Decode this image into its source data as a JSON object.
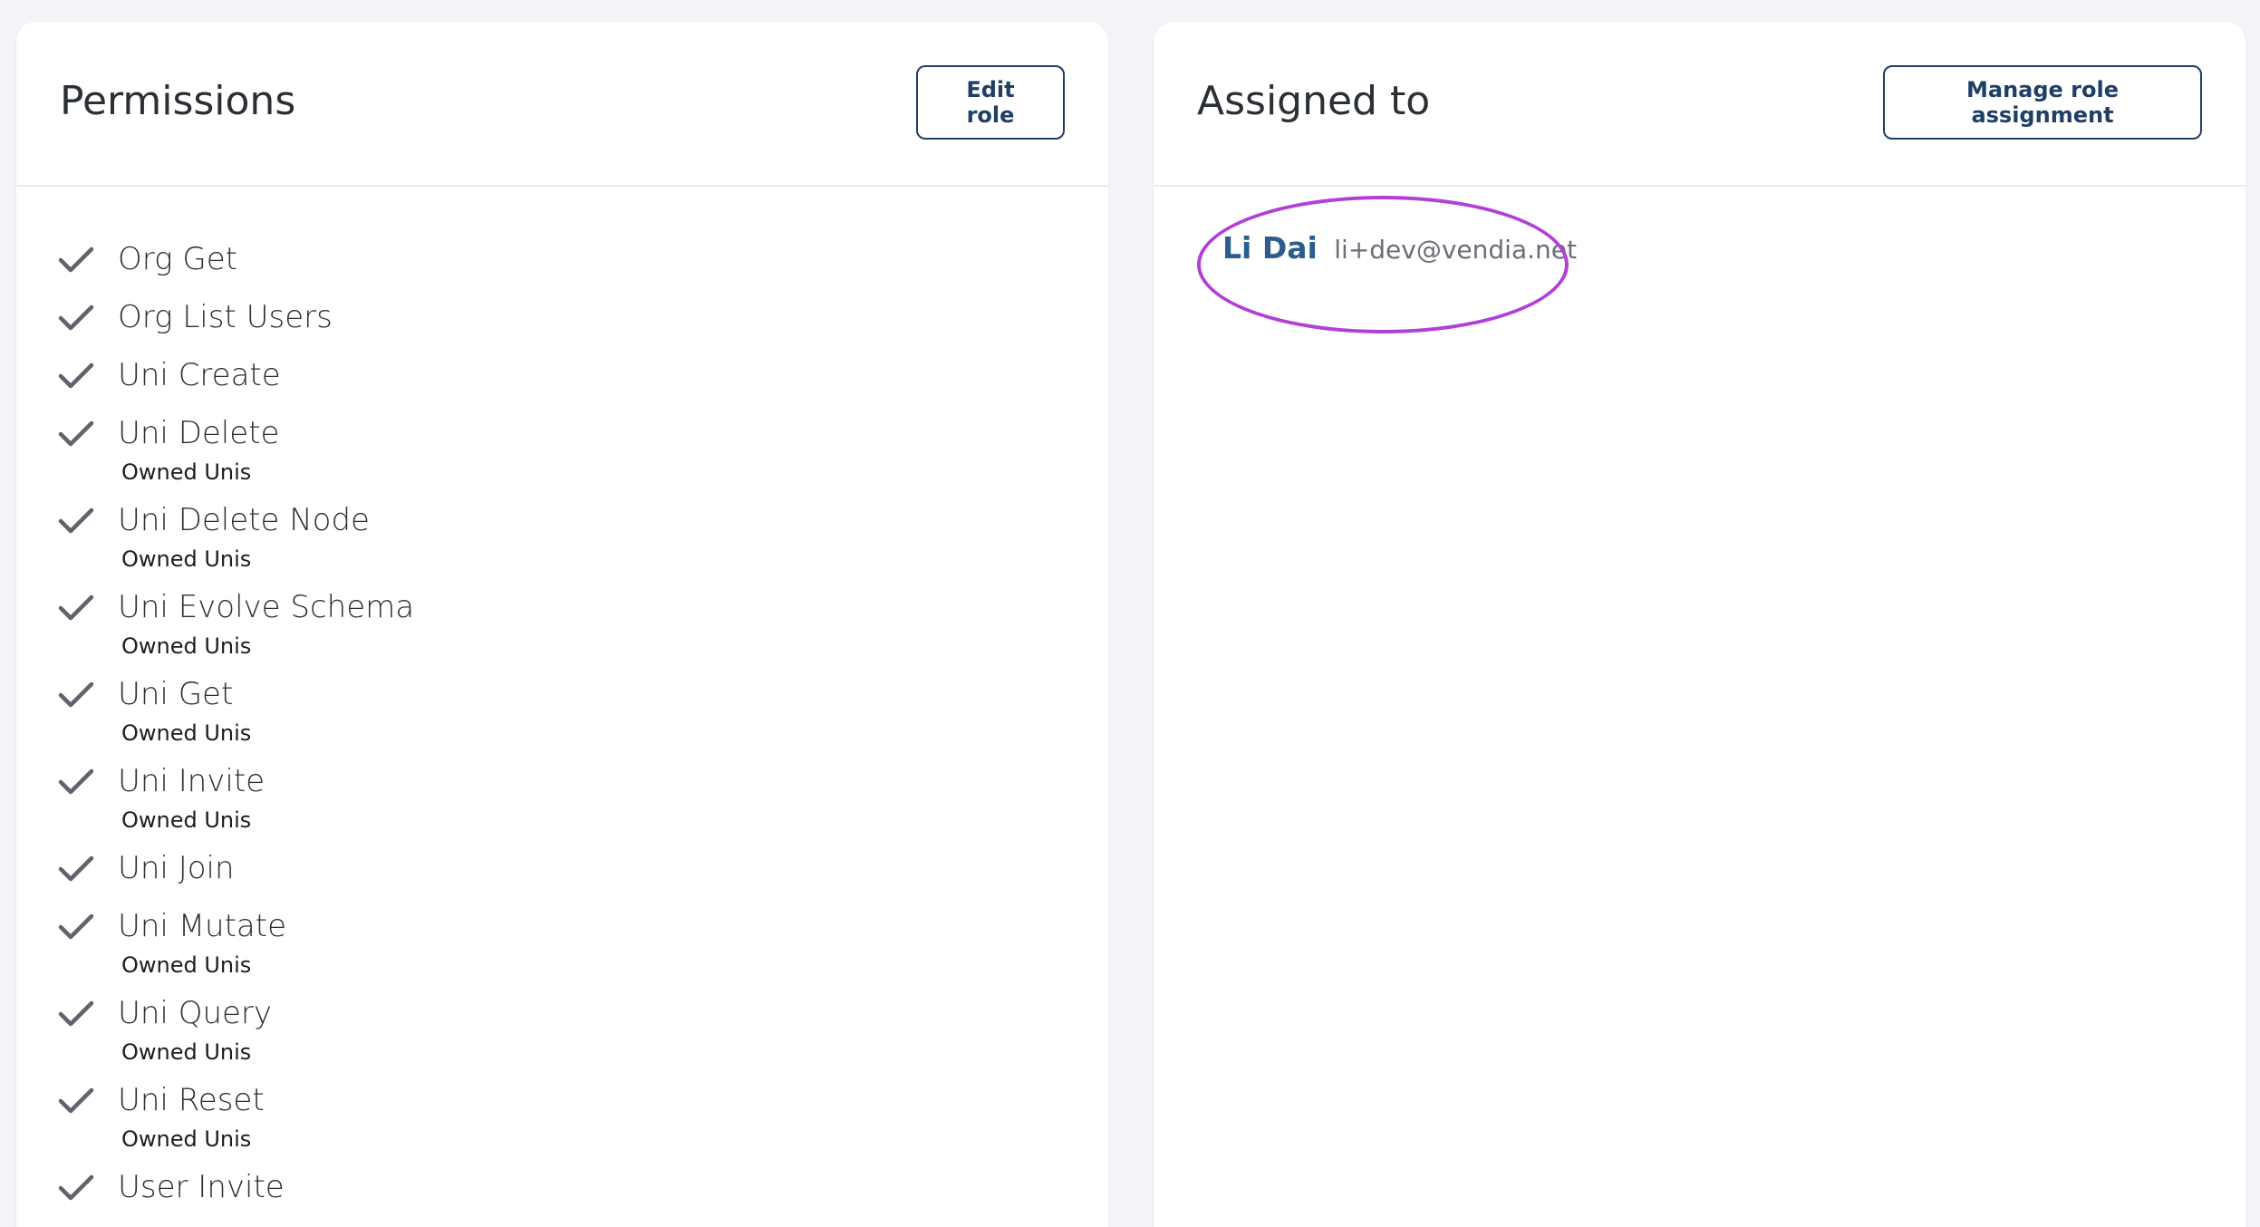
{
  "permissions_card": {
    "title": "Permissions",
    "edit_button_label": "Edit role",
    "items": [
      {
        "name": "Org Get",
        "scope": ""
      },
      {
        "name": "Org List Users",
        "scope": ""
      },
      {
        "name": "Uni Create",
        "scope": ""
      },
      {
        "name": "Uni Delete",
        "scope": "Owned Unis"
      },
      {
        "name": "Uni Delete Node",
        "scope": "Owned Unis"
      },
      {
        "name": "Uni Evolve Schema",
        "scope": "Owned Unis"
      },
      {
        "name": "Uni Get",
        "scope": "Owned Unis"
      },
      {
        "name": "Uni Invite",
        "scope": "Owned Unis"
      },
      {
        "name": "Uni Join",
        "scope": ""
      },
      {
        "name": "Uni Mutate",
        "scope": "Owned Unis"
      },
      {
        "name": "Uni Query",
        "scope": "Owned Unis"
      },
      {
        "name": "Uni Reset",
        "scope": "Owned Unis"
      },
      {
        "name": "User Invite",
        "scope": ""
      }
    ]
  },
  "assigned_card": {
    "title": "Assigned to",
    "manage_button_label": "Manage role assignment",
    "assignee": {
      "name": "Li Dai",
      "email": "li+dev@vendia.net"
    }
  },
  "colors": {
    "accent": "#1e3f66",
    "link": "#2b5e8f",
    "highlight": "#b040d8",
    "background": "#f3f4f8"
  },
  "icons": {
    "permission_check": "check-icon"
  }
}
